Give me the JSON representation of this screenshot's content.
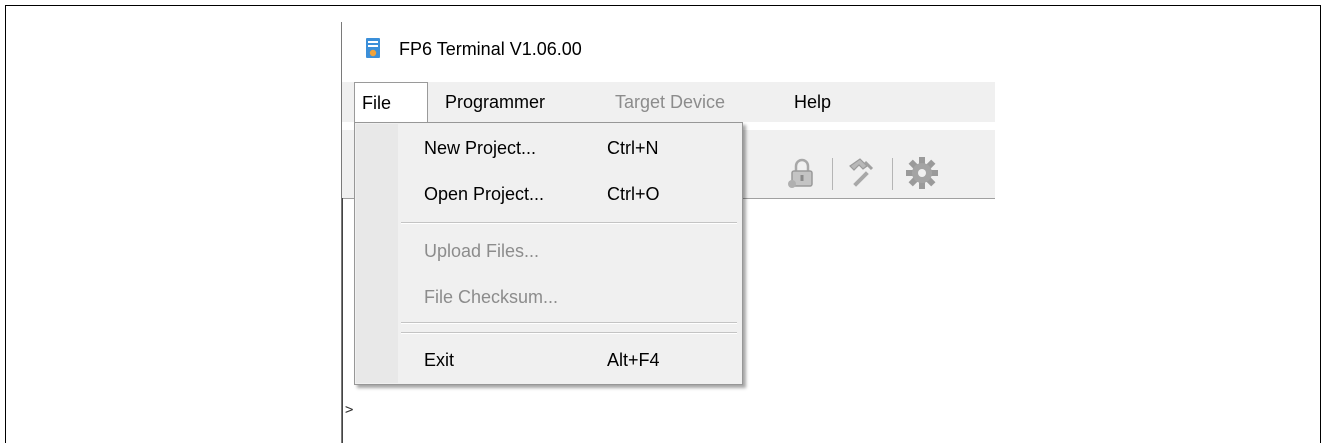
{
  "window": {
    "title": "FP6 Terminal V1.06.00"
  },
  "menubar": {
    "items": [
      {
        "label": "File",
        "state": "active"
      },
      {
        "label": "Programmer",
        "state": "enabled"
      },
      {
        "label": "Target Device",
        "state": "disabled"
      },
      {
        "label": "Help",
        "state": "enabled"
      }
    ]
  },
  "file_menu": {
    "items": [
      {
        "label": "New Project...",
        "shortcut": "Ctrl+N",
        "enabled": true
      },
      {
        "label": "Open Project...",
        "shortcut": "Ctrl+O",
        "enabled": true
      },
      {
        "label": "Upload Files...",
        "shortcut": "",
        "enabled": false
      },
      {
        "label": "File Checksum...",
        "shortcut": "",
        "enabled": false
      },
      {
        "label": "Exit",
        "shortcut": "Alt+F4",
        "enabled": true
      }
    ]
  },
  "toolbar": {
    "icons": [
      "lock-icon",
      "hammer-icon",
      "gear-icon"
    ]
  },
  "console": {
    "prompt": ">"
  },
  "colors": {
    "menubar_bg": "#f0f0f0",
    "disabled_text": "#8c8c8c",
    "icon_gray": "#9a9a9a"
  }
}
